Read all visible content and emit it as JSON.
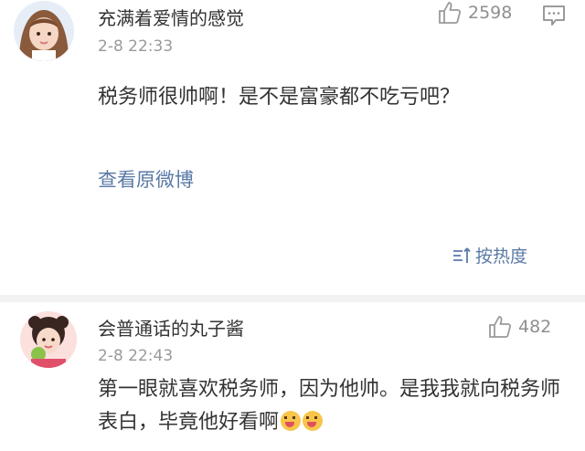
{
  "comments": [
    {
      "username": "充满着爱情的感觉",
      "time": "2-8 22:33",
      "likes": "2598",
      "text": "税务师很帅啊！是不是富豪都不吃亏吧？",
      "link": "查看原微博",
      "avatar_icon": "girl-avatar-icon"
    },
    {
      "username": "会普通话的丸子酱",
      "time": "2-8 22:43",
      "likes": "482",
      "text": "第一眼就喜欢税务师，因为他帅。是我我就向税务师表白，毕竟他好看啊",
      "emoji_count": 2,
      "avatar_icon": "girl-avatar-icon"
    }
  ],
  "sort": {
    "label": "按热度",
    "icon": "sort-icon"
  },
  "colors": {
    "link": "#5a7aa6",
    "meta": "#9a9a9a",
    "text": "#333333",
    "divider": "#f2f2f2"
  }
}
